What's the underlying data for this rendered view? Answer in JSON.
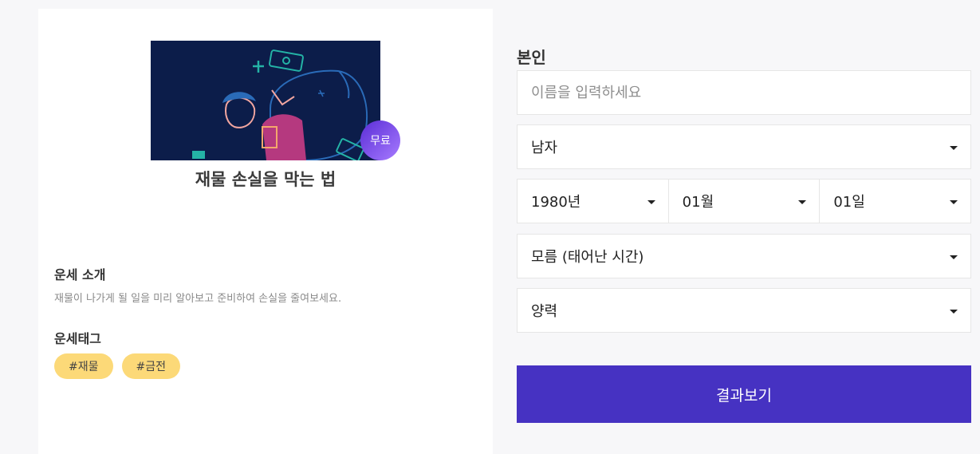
{
  "card": {
    "badge": "무료",
    "title": "재물 손실을 막는 법",
    "intro_heading": "운세 소개",
    "intro_text": "재물이 나가게 될 일을 미리 알아보고 준비하여 손실을 줄여보세요.",
    "tag_heading": "운세태그",
    "tags": [
      "#재물",
      "#금전"
    ]
  },
  "form": {
    "section_label": "본인",
    "name_placeholder": "이름을 입력하세요",
    "gender": "남자",
    "year": "1980년",
    "month": "01월",
    "day": "01일",
    "birth_time": "모름 (태어난 시간)",
    "calendar": "양력",
    "submit_label": "결과보기"
  },
  "colors": {
    "accent": "#4632c2",
    "tag_bg": "#fcd978",
    "hero_bg": "#0c1d4a"
  }
}
